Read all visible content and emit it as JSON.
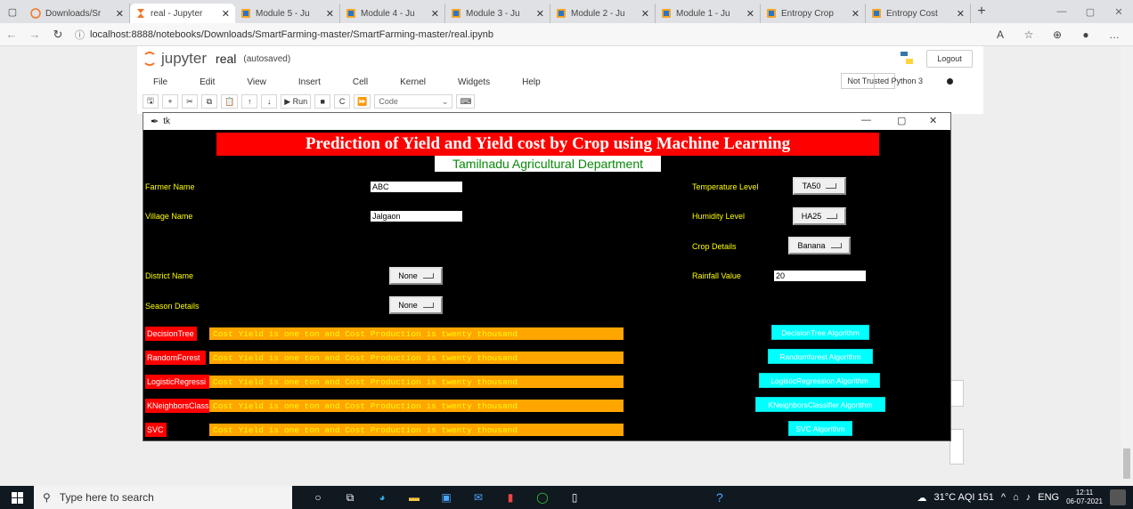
{
  "browser": {
    "tabs": [
      {
        "label": "Downloads/Sr",
        "icon": "jupyter-icon",
        "active": false
      },
      {
        "label": "real - Jupyter",
        "icon": "hourglass-icon",
        "active": true
      },
      {
        "label": "Module 5 - Ju",
        "icon": "notebook-icon",
        "active": false
      },
      {
        "label": "Module 4 - Ju",
        "icon": "notebook-icon",
        "active": false
      },
      {
        "label": "Module 3 - Ju",
        "icon": "notebook-icon",
        "active": false
      },
      {
        "label": "Module 2 - Ju",
        "icon": "notebook-icon",
        "active": false
      },
      {
        "label": "Module 1 - Ju",
        "icon": "notebook-icon",
        "active": false
      },
      {
        "label": "Entropy Crop",
        "icon": "notebook-icon",
        "active": false
      },
      {
        "label": "Entropy Cost",
        "icon": "notebook-icon",
        "active": false
      }
    ],
    "url": "localhost:8888/notebooks/Downloads/SmartFarming-master/SmartFarming-master/real.ipynb"
  },
  "jupyter": {
    "logo": "jupyter",
    "notebook_name": "real",
    "save_status": "(autosaved)",
    "logout_label": "Logout",
    "menu": [
      "File",
      "Edit",
      "View",
      "Insert",
      "Cell",
      "Kernel",
      "Widgets",
      "Help"
    ],
    "trust_label": "Not Trusted",
    "kernel_label": "Python 3",
    "run_label": "Run",
    "cell_type": "Code"
  },
  "tk": {
    "window_title": "tk",
    "title": "Prediction of Yield and Yield cost by Crop using Machine Learning",
    "subtitle": "Tamilnadu Agricultural Department",
    "fields": {
      "farmer_label": "Farmer Name",
      "farmer_value": "ABC",
      "village_label": "Village Name",
      "village_value": "Jalgaon",
      "district_label": "District Name",
      "district_value": "None",
      "season_label": "Season Details",
      "season_value": "None",
      "temperature_label": "Temperature Level",
      "temperature_value": "TA50",
      "humidity_label": "Humidity Level",
      "humidity_value": "HA25",
      "crop_label": "Crop Details",
      "crop_value": "Banana",
      "rainfall_label": "Rainfall Value",
      "rainfall_value": "20"
    },
    "algorithms": [
      {
        "label": "DecisionTree",
        "result": "Cost Yield is one ton and Cost Production is twenty thousand",
        "button": "DecisionTree Algorithm"
      },
      {
        "label": "RandomForest",
        "result": "Cost Yield is one ton and Cost Production is twenty thousand",
        "button": "Randomforest Algorithm"
      },
      {
        "label": "LogisticRegressi",
        "result": "Cost Yield is one ton and Cost Production is twenty thousand",
        "button": "LogisticRegression Algorithm"
      },
      {
        "label": "KNeighborsClass",
        "result": "Cost Yield is one ton and Cost Production is twenty thousand",
        "button": "KNeighborsClassifier Algorithm"
      },
      {
        "label": "SVC",
        "result": "Cost Yield is one ton and Cost Production is twenty thousand",
        "button": "SVC Algorithm"
      }
    ]
  },
  "taskbar": {
    "search_placeholder": "Type here to search",
    "weather": "31°C AQI 151",
    "lang": "ENG",
    "time": "12:11",
    "date": "06-07-2021"
  }
}
